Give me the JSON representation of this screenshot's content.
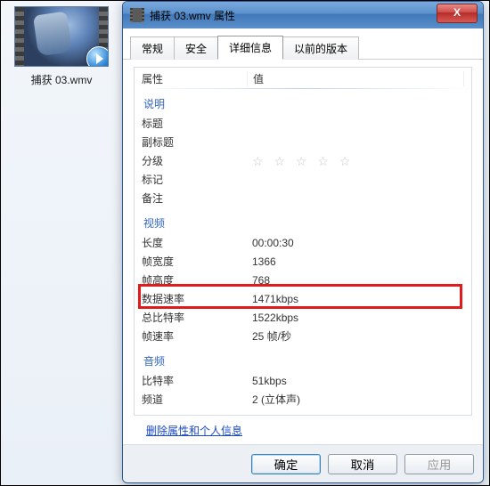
{
  "desktop": {
    "file_name": "捕获 03.wmv"
  },
  "dialog": {
    "title": "捕获 03.wmv 属性",
    "close_glyph": "X",
    "tabs": [
      "常规",
      "安全",
      "详细信息",
      "以前的版本"
    ],
    "buttons": {
      "ok": "确定",
      "cancel": "取消",
      "apply": "应用"
    }
  },
  "details": {
    "columns": {
      "property": "属性",
      "value": "值"
    },
    "sections": {
      "description": "说明",
      "video": "视频",
      "audio": "音频"
    },
    "desc": {
      "title_k": "标题",
      "title_v": "",
      "subtitle_k": "副标题",
      "subtitle_v": "",
      "rating_k": "分级",
      "rating_v": "☆ ☆ ☆ ☆ ☆",
      "tags_k": "标记",
      "tags_v": "",
      "comments_k": "备注",
      "comments_v": ""
    },
    "video": {
      "length_k": "长度",
      "length_v": "00:00:30",
      "fw_k": "帧宽度",
      "fw_v": "1366",
      "fh_k": "帧高度",
      "fh_v": "768",
      "dr_k": "数据速率",
      "dr_v": "1471kbps",
      "tbr_k": "总比特率",
      "tbr_v": "1522kbps",
      "fr_k": "帧速率",
      "fr_v": "25 帧/秒"
    },
    "audio": {
      "br_k": "比特率",
      "br_v": "51kbps",
      "ch_k": "频道",
      "ch_v": "2 (立体声)",
      "trunc_k": "",
      "trunc_v": ""
    },
    "remove_link": "删除属性和个人信息",
    "highlighted_property": "数据速率"
  }
}
